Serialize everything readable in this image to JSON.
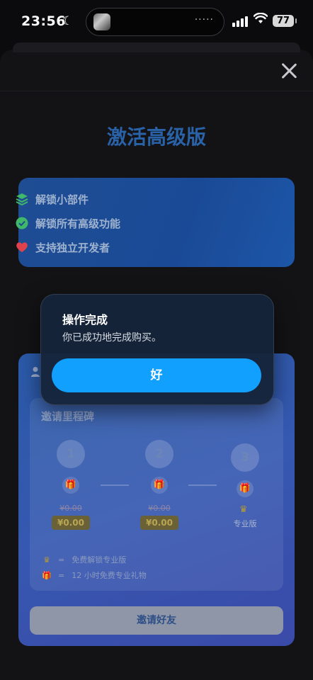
{
  "status_bar": {
    "time": "23:56",
    "battery": "77"
  },
  "sheet": {
    "title": "激活高级版"
  },
  "features": [
    {
      "label": "解锁小部件",
      "icon": "layers-icon",
      "color": "#3fb86a"
    },
    {
      "label": "解锁所有高级功能",
      "icon": "check-badge-icon",
      "color": "#3fb86a"
    },
    {
      "label": "支持独立开发者",
      "icon": "heart-icon",
      "color": "#e0424b"
    }
  ],
  "milestones": {
    "title": "邀请里程碑",
    "steps": [
      {
        "number": "1",
        "original_price": "¥0.00",
        "price": "¥0.00"
      },
      {
        "number": "2",
        "original_price": "¥0.00",
        "price": "¥0.00"
      },
      {
        "number": "3",
        "reward_label": "专业版"
      }
    ],
    "legend": [
      {
        "symbol": "crown-icon",
        "eq": "=",
        "text": "免费解锁专业版"
      },
      {
        "symbol": "gift-icon",
        "eq": "=",
        "text": "12 小时免费专业礼物"
      }
    ]
  },
  "invite_button": "邀请好友",
  "alert": {
    "title": "操作完成",
    "message": "你已成功地完成购买。",
    "ok": "好"
  },
  "colors": {
    "accent": "#12a0ff",
    "title": "#2a62a8",
    "gold": "#b59a35"
  }
}
